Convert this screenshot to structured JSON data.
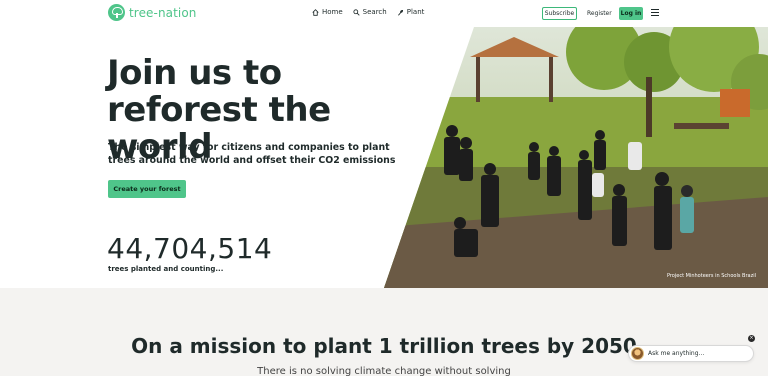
{
  "header": {
    "logo_text": "tree-nation",
    "nav": [
      {
        "label": "Home",
        "icon": "home-icon"
      },
      {
        "label": "Search",
        "icon": "search-icon"
      },
      {
        "label": "Plant",
        "icon": "sprout-icon"
      }
    ],
    "subscribe_label": "Subscribe",
    "register_label": "Register",
    "login_label": "Log in"
  },
  "hero": {
    "title": "Join us to reforest the world",
    "subtitle": "The simplest way for citizens and companies to plant trees around the world and offset their CO2 emissions",
    "cta_label": "Create your forest",
    "counter": "44,704,514",
    "counter_label": "trees planted and counting...",
    "photo_caption": "Project Minhoteers in Schools Brazil"
  },
  "mission": {
    "title": "On a mission to plant 1 trillion trees by 2050",
    "subtitle": "There is no solving climate change without solving"
  },
  "chat": {
    "placeholder": "Ask me anything...",
    "close_label": "×"
  },
  "colors": {
    "brand_green": "#4fc58a",
    "text_dark": "#1f2a2a",
    "lower_bg": "#f4f3f1"
  }
}
